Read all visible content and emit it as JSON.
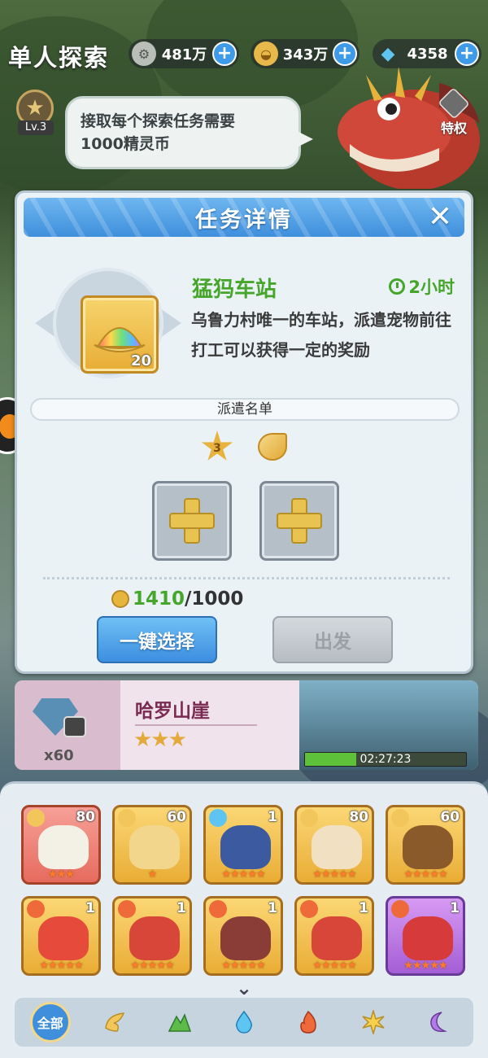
{
  "header": {
    "title": "单人探索",
    "currencies": [
      {
        "icon": "gear-coin-icon",
        "value": "481万"
      },
      {
        "icon": "shell-icon",
        "value": "343万"
      },
      {
        "icon": "diamond-icon",
        "value": "4358"
      }
    ]
  },
  "level_badge": "Lv.3",
  "hint_bubble": {
    "line1": "接取每个探索任务需要",
    "line2": "1000精灵币"
  },
  "privilege_label": "特权",
  "task_dialog": {
    "title": "任务详情",
    "close_glyph": "✕",
    "reward_quantity": "20",
    "task_name": "猛犸车站",
    "duration": "2小时",
    "description": "乌鲁力村唯一的车站，派遣宠物前往打工可以获得一定的奖励",
    "roster_label": "派遣名单",
    "star_requirement": "3",
    "cost_have": "1410",
    "cost_need": "/1000",
    "auto_select_label": "一键选择",
    "depart_label": "出发"
  },
  "location_card": {
    "name": "哈罗山崖",
    "lock_reward_qty": "x60",
    "stars": "★★★",
    "timer": "02:27:23",
    "timer_progress": 0.32
  },
  "pets": [
    {
      "attr": "wing-icon",
      "level": "80",
      "stars": 3,
      "frame": "red"
    },
    {
      "attr": "wing-icon",
      "level": "60",
      "stars": 1,
      "frame": "gold"
    },
    {
      "attr": "water-icon",
      "level": "1",
      "stars": 5,
      "frame": "gold"
    },
    {
      "attr": "wing-icon",
      "level": "80",
      "stars": 5,
      "frame": "gold"
    },
    {
      "attr": "wing-icon",
      "level": "60",
      "stars": 5,
      "frame": "gold"
    },
    {
      "attr": "fire-icon",
      "level": "1",
      "stars": 5,
      "frame": "gold"
    },
    {
      "attr": "fire-icon",
      "level": "1",
      "stars": 5,
      "frame": "gold"
    },
    {
      "attr": "fire-icon",
      "level": "1",
      "stars": 5,
      "frame": "gold"
    },
    {
      "attr": "fire-icon",
      "level": "1",
      "stars": 5,
      "frame": "gold"
    },
    {
      "attr": "fire-icon",
      "level": "1",
      "stars": 5,
      "frame": "purple"
    }
  ],
  "filters": {
    "all_label": "全部",
    "icons": [
      "wing-icon",
      "grass-icon",
      "water-icon",
      "fire-icon",
      "light-icon",
      "moon-icon"
    ]
  },
  "colors": {
    "accent_blue": "#3f8fdc",
    "task_green": "#45a62b",
    "gold_frame": "#e9ad35"
  }
}
